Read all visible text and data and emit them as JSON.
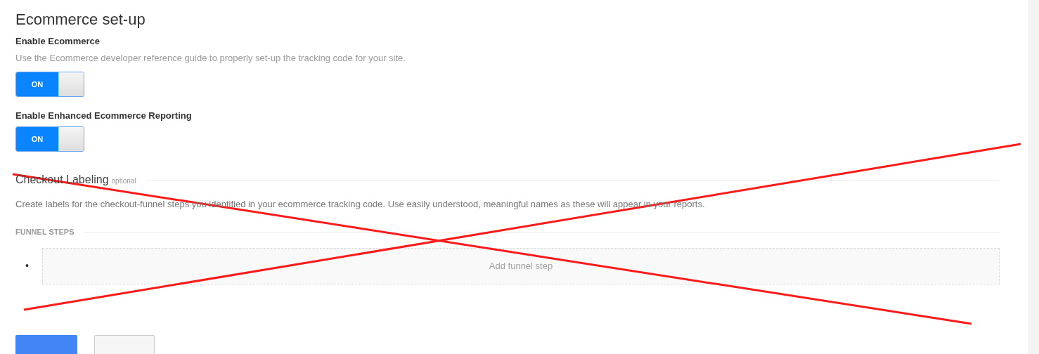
{
  "title": "Ecommerce set-up",
  "settings": [
    {
      "label": "Enable Ecommerce",
      "description": "Use the Ecommerce developer reference guide to properly set-up the tracking code for your site.",
      "toggle": {
        "on": true,
        "text": "ON"
      }
    },
    {
      "label": "Enable Enhanced Ecommerce Reporting",
      "toggle": {
        "on": true,
        "text": "ON"
      }
    }
  ],
  "checkout_labeling": {
    "title": "Checkout Labeling",
    "tag": "optional",
    "description": "Create labels for the checkout-funnel steps you identified in your ecommerce tracking code. Use easily understood, meaningful names as these will appear in your reports.",
    "funnel_heading": "FUNNEL STEPS",
    "steps": [
      {
        "bullet": "•",
        "placeholder": "Add funnel step"
      }
    ]
  },
  "buttons": [
    {
      "kind": "primary"
    },
    {
      "kind": "secondary"
    }
  ],
  "annotation": {
    "kind": "cross"
  }
}
